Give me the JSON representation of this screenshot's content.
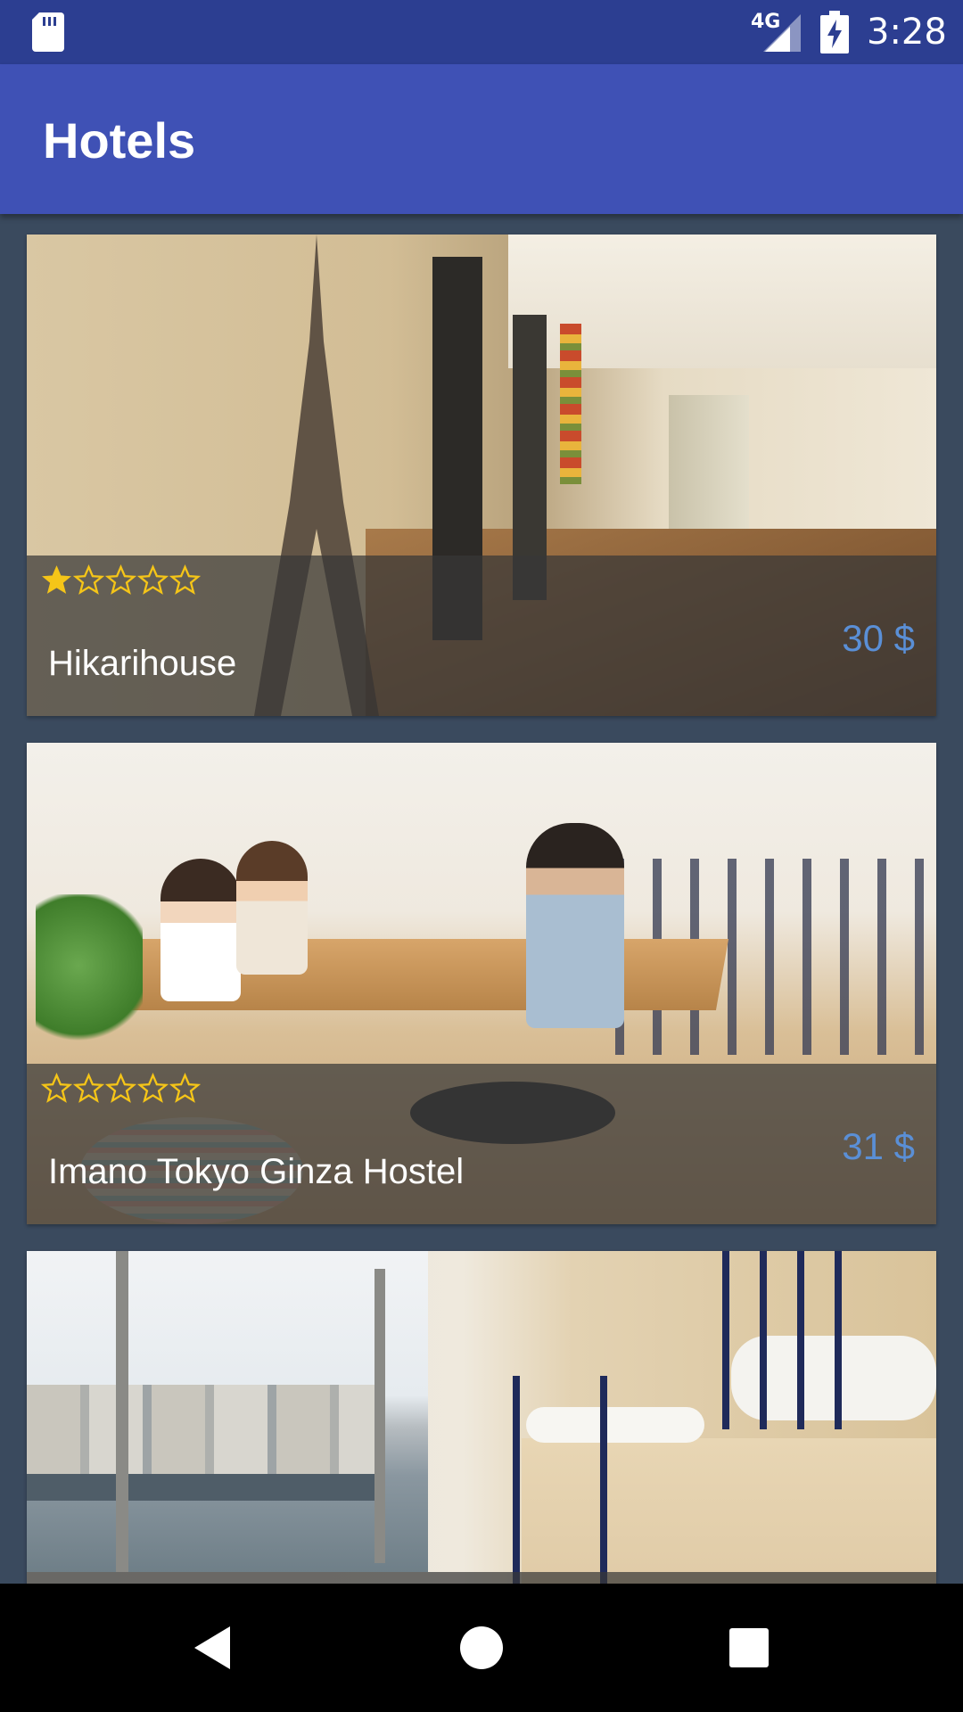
{
  "status_bar": {
    "network": "4G",
    "time": "3:28",
    "icons": [
      "sd-card-icon",
      "signal-icon",
      "battery-charging-icon"
    ]
  },
  "app_bar": {
    "title": "Hotels"
  },
  "hotels": [
    {
      "name": "Hikarihouse",
      "price": "30 $",
      "rating": 1,
      "max_rating": 5
    },
    {
      "name": "Imano Tokyo Ginza Hostel",
      "price": "31 $",
      "rating": 0,
      "max_rating": 5
    },
    {
      "name": "",
      "price": "",
      "rating": 0,
      "max_rating": 5
    }
  ],
  "nav_bar": {
    "icons": [
      "back-icon",
      "home-icon",
      "recents-icon"
    ]
  },
  "colors": {
    "status_bar": "#2c3e91",
    "app_bar": "#3f51b5",
    "list_background": "#3a4a5e",
    "price": "#5a8fd6",
    "star": "#f5c518"
  }
}
